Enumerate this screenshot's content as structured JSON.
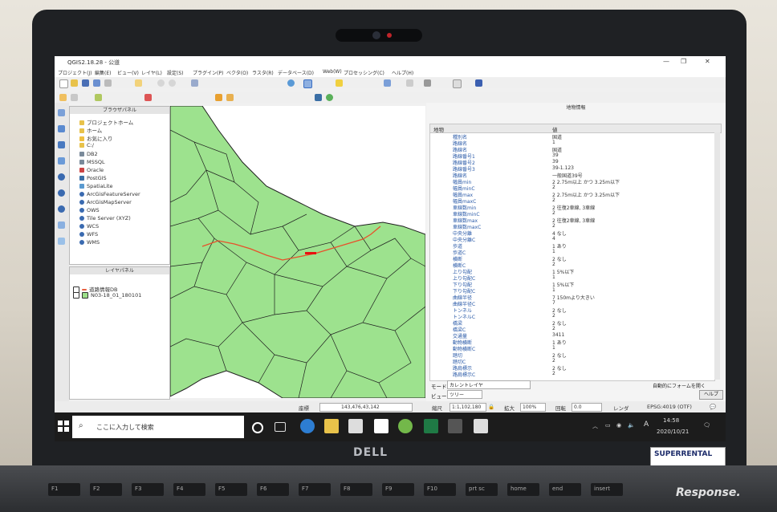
{
  "window": {
    "title": "QGIS2.18.28 - 公道"
  },
  "menu": [
    "プロジェクト(J)",
    "編集(E)",
    "ビュー(V)",
    "レイヤ(L)",
    "設定(S)",
    "プラグイン(P)",
    "ベクタ(O)",
    "ラスタ(R)",
    "データベース(D)",
    "Web(W)",
    "プロセッシング(C)",
    "ヘルプ(H)"
  ],
  "browser_panel": {
    "title": "ブラウザパネル",
    "items": [
      "プロジェクトホーム",
      "ホーム",
      "お気に入り",
      "C:/",
      "DB2",
      "MSSQL",
      "Oracle",
      "PostGIS",
      "SpatiaLite",
      "ArcGisFeatureServer",
      "ArcGisMapServer",
      "OWS",
      "Tile Server (XYZ)",
      "WCS",
      "WFS",
      "WMS"
    ]
  },
  "layer_panel": {
    "title": "レイヤパネル",
    "layers": [
      "道路情報DB",
      "N03-18_01_180101"
    ]
  },
  "identify_panel": {
    "title": "地物情報",
    "col_feature": "地物",
    "col_value": "値",
    "rows": [
      [
        "種別名",
        "国道"
      ],
      [
        "路線名",
        "1"
      ],
      [
        "路線名",
        "国道"
      ],
      [
        "路線番号1",
        "39"
      ],
      [
        "路線番号2",
        "39"
      ],
      [
        "路線番号3",
        "39-1.123"
      ],
      [
        "路線名",
        "一般国道39号"
      ],
      [
        "幅員min",
        "2 2.75m以上 かつ 3.25m以下"
      ],
      [
        "幅員minC",
        "2"
      ],
      [
        "幅員max",
        "2 2.75m以上 かつ 3.25m以下"
      ],
      [
        "幅員maxC",
        "2"
      ],
      [
        "車線数min",
        "2 往復2車線, 3車線"
      ],
      [
        "車線数minC",
        "2"
      ],
      [
        "車線数max",
        "2 往復2車線, 3車線"
      ],
      [
        "車線数maxC",
        "2"
      ],
      [
        "中央分離",
        "4 なし"
      ],
      [
        "中央分離C",
        "4"
      ],
      [
        "歩道",
        "1 あり"
      ],
      [
        "歩道C",
        "1"
      ],
      [
        "横断",
        "2 なし"
      ],
      [
        "横断C",
        "2"
      ],
      [
        "上り勾配",
        "1 5%以下"
      ],
      [
        "上り勾配C",
        "1"
      ],
      [
        "下り勾配",
        "1 5%以下"
      ],
      [
        "下り勾配C",
        "1"
      ],
      [
        "曲線半径",
        "7 150mより大きい"
      ],
      [
        "曲線半径C",
        "7"
      ],
      [
        "トンネル",
        "2 なし"
      ],
      [
        "トンネルC",
        "2"
      ],
      [
        "橋梁",
        "2 なし"
      ],
      [
        "橋梁C",
        "2"
      ],
      [
        "交通量",
        "3411"
      ],
      [
        "動物横断",
        "1 あり"
      ],
      [
        "動物横断C",
        "1"
      ],
      [
        "踏切",
        "2 なし"
      ],
      [
        "踏切C",
        "2"
      ],
      [
        "路肩標示",
        "2 なし"
      ],
      [
        "路肩標示C",
        "2"
      ]
    ],
    "mode_label": "モード",
    "mode_value": "カレントレイヤ",
    "view_label": "ビュー",
    "view_value": "ツリー",
    "auto_form": "自動的にフォームを開く",
    "help_button": "ヘルプ"
  },
  "statusbar": {
    "coord_label": "座標",
    "coord_value": "143,476,43,142",
    "scale_label": "縮尺",
    "scale_value": "1:1,102,180",
    "zoom_label": "拡大",
    "zoom_value": "100%",
    "rotate_label": "回転",
    "rotate_value": "0.0",
    "render_label": "レンダ",
    "crs": "EPSG:4019 (OTF)"
  },
  "taskbar": {
    "search_placeholder": "ここに入力して検索",
    "time": "14:58",
    "date": "2020/10/21",
    "ime": "A"
  },
  "laptop": {
    "brand": "DELL",
    "sticker": "SUPERRENTAL"
  },
  "keyboard_keys": [
    "F1",
    "F2",
    "F3",
    "F4",
    "F5",
    "F6",
    "F7",
    "F8",
    "F9",
    "F10",
    "prt sc",
    "home",
    "end",
    "insert"
  ],
  "watermark": "Response."
}
